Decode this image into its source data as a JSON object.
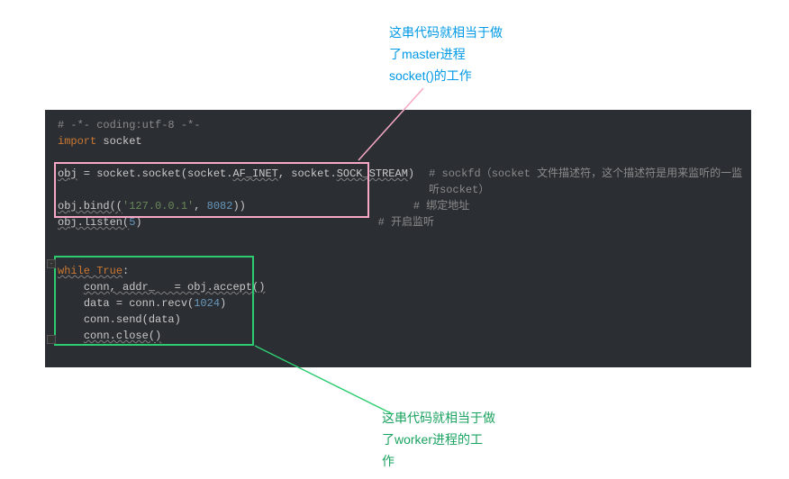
{
  "annotation_top": {
    "line1": "这串代码就相当于做",
    "line2": "了master进程",
    "line3": "socket()的工作"
  },
  "annotation_bottom": {
    "line1": "这串代码就相当于做",
    "line2": "了worker进程的工",
    "line3": "作"
  },
  "code": {
    "l1_comment": "# -*- coding:utf-8 -*-",
    "l2_import": "import",
    "l2_module": " socket",
    "l4_obj": "obj",
    "l4_eq": " = ",
    "l4_expr1": "socket.socket(socket.",
    "l4_af": "AF_INET",
    "l4_sep": ", socket.",
    "l4_ss": "SOCK_STREAM",
    "l4_close": ")",
    "l4_rcomment": "# sockfd（socket 文件描述符，这个描述符是用来监听的一监听socket）",
    "l5_pre": "obj.bind((",
    "l5_host": "'127.0.0.1'",
    "l5_comma": ", ",
    "l5_port": "8082",
    "l5_close": "))",
    "l5_rcomment": "# 绑定地址",
    "l6_pre": "obj.listen(",
    "l6_n": "5",
    "l6_close": ")",
    "l6_rcomment": "# 开启监听",
    "l8_while": "while",
    "l8_true": " True",
    "l8_colon": ":",
    "l9_line": "conn, addr_   = obj.accept()",
    "l10_pre": "data = conn.recv(",
    "l10_n": "1024",
    "l10_close": ")",
    "l11_line": "conn.send(data)",
    "l12_line": "conn.close()"
  }
}
